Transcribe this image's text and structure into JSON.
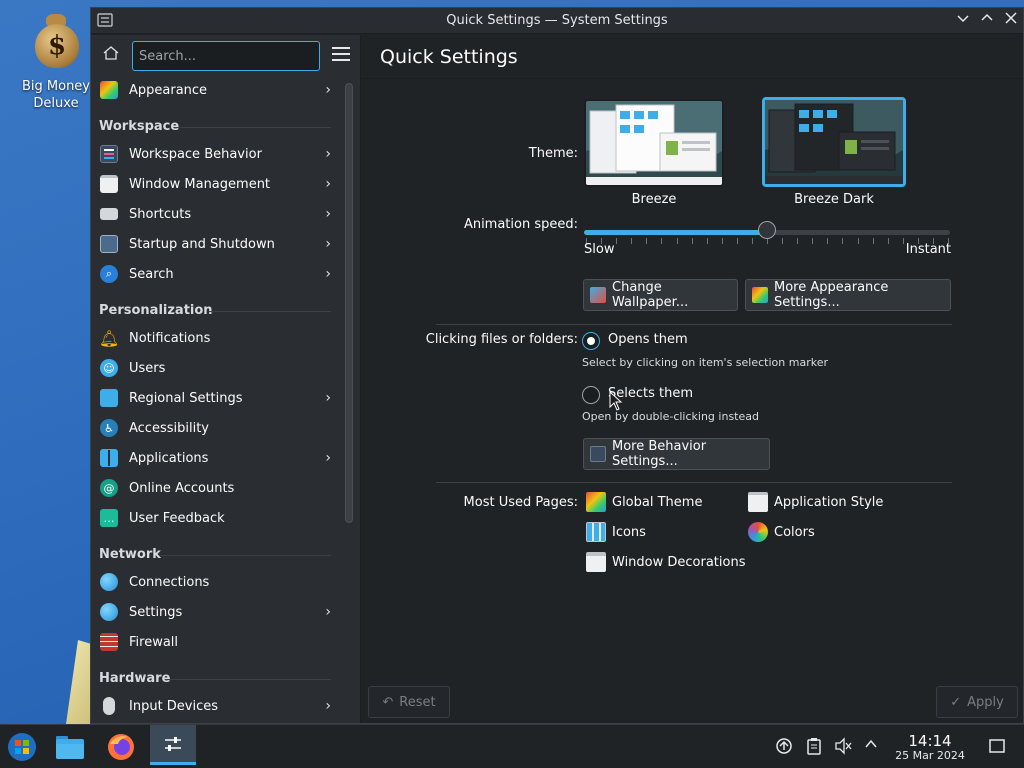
{
  "desktop": {
    "icon_label": "Big Money\nDeluxe"
  },
  "window": {
    "title": "Quick Settings — System Settings"
  },
  "sidebar": {
    "search_placeholder": "Search...",
    "top_item": {
      "label": "Appearance",
      "icon": "appearance-icon",
      "has_children": true
    },
    "sections": [
      {
        "title": "Workspace",
        "items": [
          {
            "label": "Workspace Behavior",
            "icon": "workspace-behavior-icon",
            "has_children": true
          },
          {
            "label": "Window Management",
            "icon": "window-management-icon",
            "has_children": true
          },
          {
            "label": "Shortcuts",
            "icon": "keyboard-icon",
            "has_children": true
          },
          {
            "label": "Startup and Shutdown",
            "icon": "startup-icon",
            "has_children": true
          },
          {
            "label": "Search",
            "icon": "search-icon",
            "has_children": true
          }
        ]
      },
      {
        "title": "Personalization",
        "items": [
          {
            "label": "Notifications",
            "icon": "bell-icon",
            "has_children": false
          },
          {
            "label": "Users",
            "icon": "users-icon",
            "has_children": false
          },
          {
            "label": "Regional Settings",
            "icon": "regional-icon",
            "has_children": true
          },
          {
            "label": "Accessibility",
            "icon": "accessibility-icon",
            "has_children": false
          },
          {
            "label": "Applications",
            "icon": "applications-icon",
            "has_children": true
          },
          {
            "label": "Online Accounts",
            "icon": "online-accounts-icon",
            "has_children": false
          },
          {
            "label": "User Feedback",
            "icon": "feedback-icon",
            "has_children": false
          }
        ]
      },
      {
        "title": "Network",
        "items": [
          {
            "label": "Connections",
            "icon": "globe-icon",
            "has_children": false
          },
          {
            "label": "Settings",
            "icon": "globe-icon",
            "has_children": true
          },
          {
            "label": "Firewall",
            "icon": "firewall-icon",
            "has_children": false
          }
        ]
      },
      {
        "title": "Hardware",
        "items": [
          {
            "label": "Input Devices",
            "icon": "mouse-icon",
            "has_children": true
          }
        ]
      }
    ]
  },
  "main": {
    "title": "Quick Settings",
    "theme_label": "Theme:",
    "themes": [
      {
        "name": "Breeze",
        "selected": false
      },
      {
        "name": "Breeze Dark",
        "selected": true
      }
    ],
    "animation_label": "Animation speed:",
    "animation_value": 0.5,
    "slider_min_label": "Slow",
    "slider_max_label": "Instant",
    "change_wallpaper": "Change Wallpaper...",
    "more_appearance": "More Appearance Settings...",
    "clicking_label": "Clicking files or folders:",
    "option_open": "Opens them",
    "option_open_hint": "Select by clicking on item's selection marker",
    "option_select": "Selects them",
    "option_select_hint": "Open by double-clicking instead",
    "selected_option": "open",
    "more_behavior": "More Behavior Settings...",
    "most_used_label": "Most Used Pages:",
    "most_used": [
      {
        "label": "Global Theme",
        "icon": "global-theme-icon"
      },
      {
        "label": "Application Style",
        "icon": "application-style-icon"
      },
      {
        "label": "Icons",
        "icon": "icons-icon"
      },
      {
        "label": "Colors",
        "icon": "colors-icon"
      },
      {
        "label": "Window Decorations",
        "icon": "window-decorations-icon"
      }
    ],
    "reset_label": "Reset",
    "apply_label": "Apply"
  },
  "taskbar": {
    "time": "14:14",
    "date": "25 Mar 2024",
    "apps": [
      {
        "name": "start-menu",
        "active": false
      },
      {
        "name": "file-manager",
        "active": false
      },
      {
        "name": "firefox",
        "active": false
      },
      {
        "name": "system-settings",
        "active": true
      }
    ]
  }
}
